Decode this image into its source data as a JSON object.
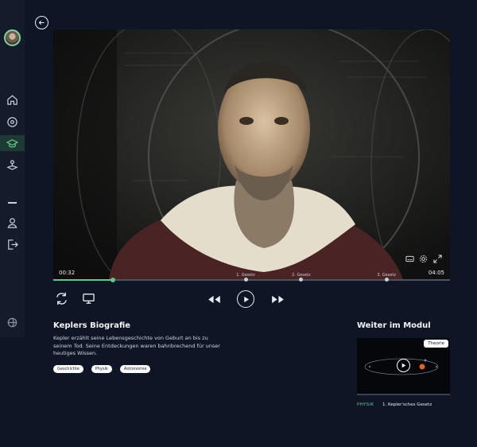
{
  "sidebar": {
    "items": [
      {
        "icon": "home-icon"
      },
      {
        "icon": "compass-icon"
      },
      {
        "icon": "graduation-cap-icon",
        "active": true
      },
      {
        "icon": "joystick-icon"
      },
      {
        "icon": "minus-icon"
      },
      {
        "icon": "user-icon"
      },
      {
        "icon": "logout-icon"
      },
      {
        "icon": "globe-icon"
      }
    ]
  },
  "player": {
    "time_current": "00:32",
    "time_total": "04:05",
    "progress": 0.15,
    "chapters": [
      {
        "label": "1. Gesetz",
        "position": 0.485
      },
      {
        "label": "2. Gesetz",
        "position": 0.625
      },
      {
        "label": "3. Gesetz",
        "position": 0.84
      }
    ]
  },
  "video": {
    "title": "Keplers Biografie",
    "description": "Kepler erzählt seine Lebensgeschichte von Geburt an bis zu seinem Tod. Seine Entdeckungen waren bahnbrechend für unser heutiges Wissen.",
    "tags": [
      "Geschichte",
      "Physik",
      "Astronomie"
    ]
  },
  "next": {
    "heading": "Weiter im Modul",
    "badge": "Theorie",
    "subject": "PHYSIK",
    "lesson": "1. Kepler'sches Gesetz"
  },
  "colors": {
    "accent": "#5ec98a",
    "background": "#0e1524",
    "sidebar": "#141b2a"
  }
}
